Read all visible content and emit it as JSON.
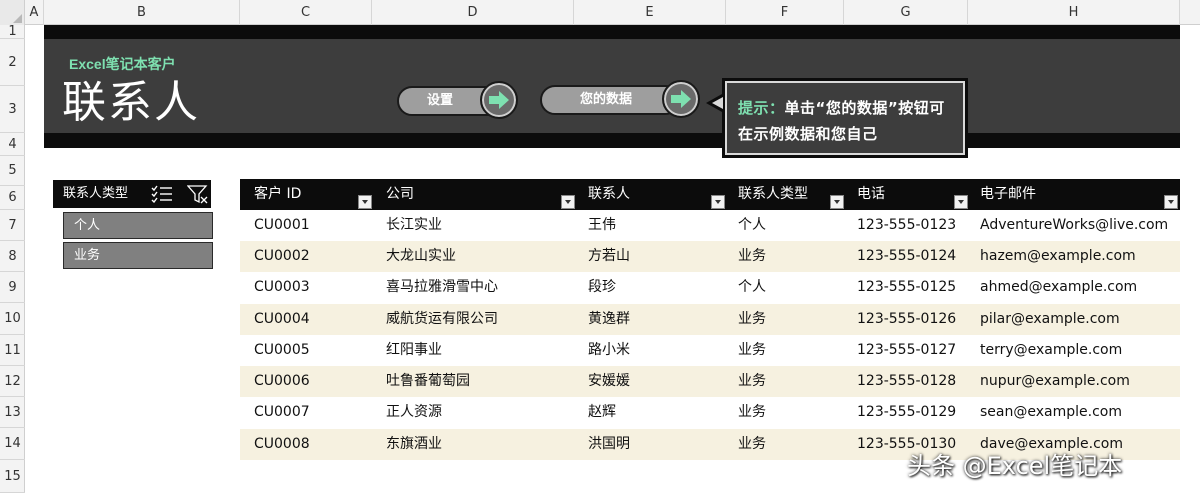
{
  "columns": [
    "A",
    "B",
    "C",
    "D",
    "E",
    "F",
    "G",
    "H"
  ],
  "rows": [
    "1",
    "2",
    "3",
    "4",
    "5",
    "6",
    "7",
    "8",
    "9",
    "10",
    "11",
    "12",
    "13",
    "14",
    "15"
  ],
  "banner": {
    "subtitle": "Excel笔记本客户",
    "title": "联系人",
    "buttons": [
      {
        "label": "设置"
      },
      {
        "label": "您的数据"
      }
    ],
    "tip": {
      "prefix": "提示：",
      "text": "单击“您的数据”按钮可在示例数据和您自己"
    }
  },
  "slicer": {
    "title": "联系人类型",
    "items": [
      "个人",
      "业务"
    ]
  },
  "table": {
    "headers": [
      "客户 ID",
      "公司",
      "联系人",
      "联系人类型",
      "电话",
      "电子邮件"
    ],
    "rows": [
      [
        "CU0001",
        "长江实业",
        "王伟",
        "个人",
        "123-555-0123",
        "AdventureWorks@live.com"
      ],
      [
        "CU0002",
        "大龙山实业",
        "方若山",
        "业务",
        "123-555-0124",
        "hazem@example.com"
      ],
      [
        "CU0003",
        "喜马拉雅滑雪中心",
        "段珍",
        "个人",
        "123-555-0125",
        "ahmed@example.com"
      ],
      [
        "CU0004",
        "威航货运有限公司",
        "黄逸群",
        "业务",
        "123-555-0126",
        "pilar@example.com"
      ],
      [
        "CU0005",
        "红阳事业",
        "路小米",
        "业务",
        "123-555-0127",
        "terry@example.com"
      ],
      [
        "CU0006",
        "吐鲁番葡萄园",
        "安媛媛",
        "业务",
        "123-555-0128",
        "nupur@example.com"
      ],
      [
        "CU0007",
        "正人资源",
        "赵辉",
        "业务",
        "123-555-0129",
        "sean@example.com"
      ],
      [
        "CU0008",
        "东旗酒业",
        "洪国明",
        "业务",
        "123-555-0130",
        "dave@example.com"
      ]
    ]
  },
  "watermark": "头条 @Excel笔记本",
  "colors": {
    "banner_dark": "#3d3d3d",
    "banner_black": "#0c0c0c",
    "accent_green": "#7ee0b0",
    "row_alt": "#f6f1e0",
    "slicer_item": "#808080"
  }
}
